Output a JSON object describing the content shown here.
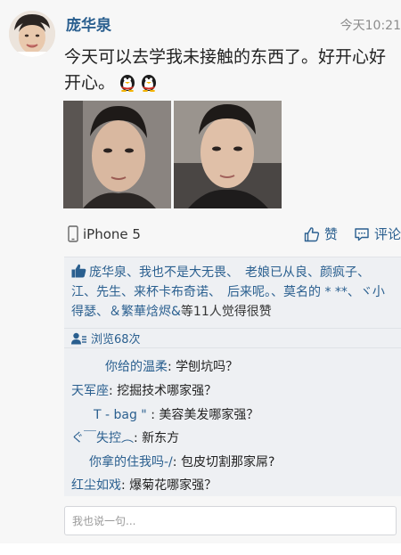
{
  "post": {
    "username": "庞华泉",
    "timestamp": "今天10:21",
    "text": "今天可以去学我未接触的东西了。好开心好开心。",
    "device": "iPhone 5"
  },
  "actions": {
    "like_label": "赞",
    "comment_label": "评论"
  },
  "likes": {
    "names": "庞华泉、我也不是大无畏、　老娘已从良、颜疯子、　江、先生、来杯卡布奇诺、　后来呢。、莫名的 * **、ヾ小得瑟、＆繁華焓烬&",
    "count_text": "等11人觉得很赞"
  },
  "views": {
    "text": "浏览68次"
  },
  "comments": [
    {
      "author": "你给的温柔",
      "text": ": 学刨坑吗？"
    },
    {
      "author": "天军座",
      "text": ": 挖掘技术哪家强？"
    },
    {
      "author": "T - bag \"",
      "text": " : 美容美发哪家强？"
    },
    {
      "author": "ぐ￣失控︵",
      "text": ": 新东方"
    },
    {
      "author": "你拿的住我吗-/",
      "text": ": 包皮切割那家屌?"
    },
    {
      "author": "红尘如戏",
      "text": ": 爆菊花哪家强？"
    }
  ],
  "comment_input": {
    "placeholder": "我也说一句..."
  },
  "icons": {
    "avatar": "avatar",
    "emoji": "qq-penguin-emoji",
    "device": "phone-icon",
    "like": "thumbs-up-icon",
    "comment": "comment-bubble-icon",
    "likes_thumb": "thumbs-up-filled-icon",
    "views": "person-views-icon"
  },
  "colors": {
    "link": "#2a5f8f",
    "text": "#222222",
    "meta": "#8c8c8c",
    "panel": "#eef0f3"
  }
}
